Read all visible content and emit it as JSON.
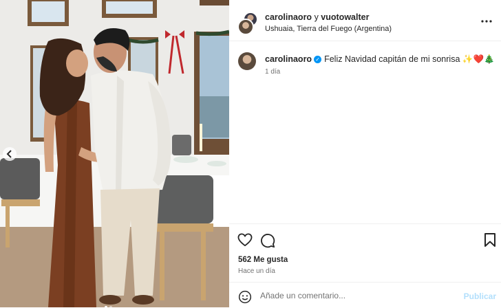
{
  "post": {
    "photo": {
      "alt_description": "",
      "icons": {
        "prev": "chevron-left-icon"
      }
    },
    "header": {
      "user1": "carolinaoro",
      "joiner": "y",
      "user2": "vuotowalter",
      "location": "Ushuaia, Tierra del Fuego (Argentina)",
      "more_icon": "more-horizontal-icon"
    },
    "caption": {
      "user": "carolinaoro",
      "text": "Feliz Navidad capitán de mi sonrisa",
      "emoji": "✨❤️🎄",
      "time": "1 día"
    },
    "actions": {
      "like_icon": "heart-icon",
      "comment_icon": "comment-icon",
      "save_icon": "bookmark-icon"
    },
    "likes": "562 Me gusta",
    "posted_ago": "Hace un día",
    "comment": {
      "placeholder": "Añade un comentario...",
      "publish_label": "Publicar",
      "emoji_icon": "smiley-icon"
    }
  },
  "colors": {
    "accent": "#0095f6",
    "publish_disabled": "#b2dffc",
    "secondary_text": "#737373",
    "heart_red": "#ed4956"
  }
}
